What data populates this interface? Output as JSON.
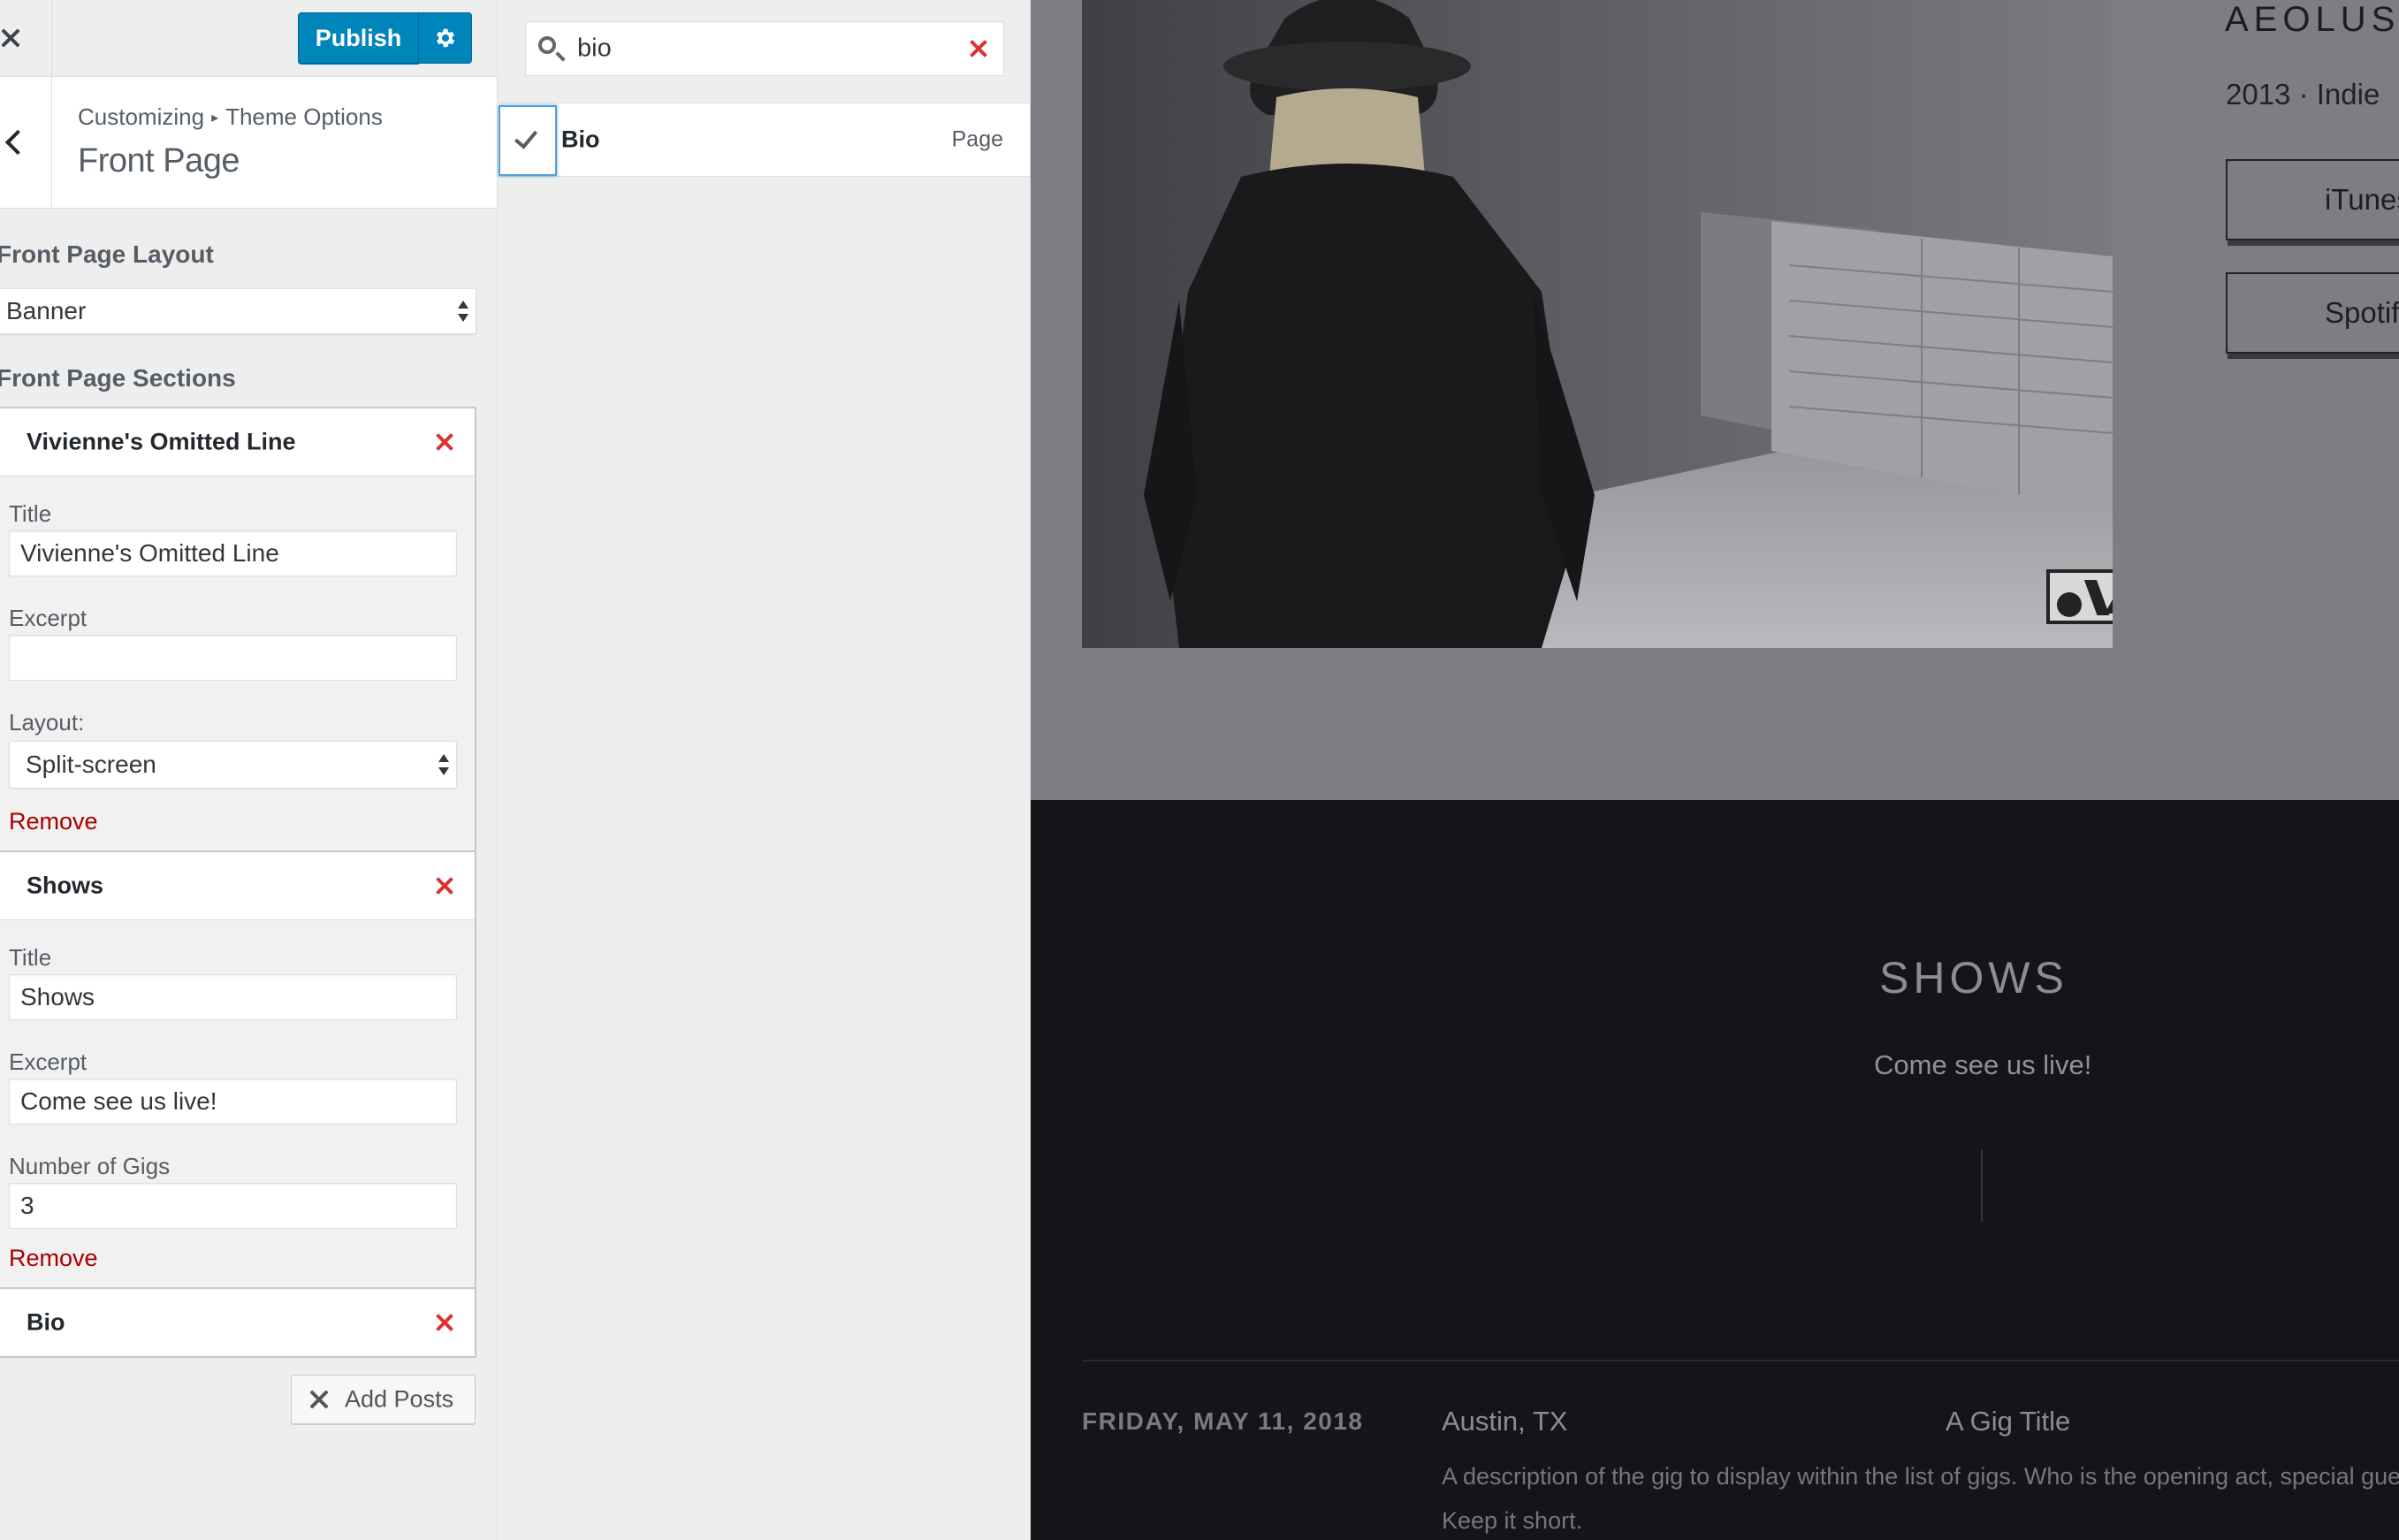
{
  "topbar": {
    "close_icon": "close-icon",
    "publish_label": "Publish",
    "settings_icon": "gear-icon"
  },
  "section_header": {
    "breadcrumb_part1": "Customizing",
    "breadcrumb_separator": "▸",
    "breadcrumb_part2": "Theme Options",
    "title": "Front Page"
  },
  "layout": {
    "heading": "Front Page Layout",
    "selected": "Banner"
  },
  "sections": {
    "heading": "Front Page Sections",
    "items": [
      {
        "name": "Vivienne's Omitted Line",
        "title_label": "Title",
        "title_value": "Vivienne's Omitted Line",
        "excerpt_label": "Excerpt",
        "excerpt_value": "",
        "layout_label": "Layout:",
        "layout_value": "Split-screen",
        "remove_label": "Remove"
      },
      {
        "name": "Shows",
        "title_label": "Title",
        "title_value": "Shows",
        "excerpt_label": "Excerpt",
        "excerpt_value": "Come see us live!",
        "gigs_label": "Number of Gigs",
        "gigs_value": "3",
        "remove_label": "Remove"
      },
      {
        "name": "Bio"
      }
    ],
    "add_posts_label": "Add Posts"
  },
  "available_items": {
    "search_value": "bio",
    "results": [
      {
        "title": "Bio",
        "type": "Page",
        "selected": true
      }
    ]
  },
  "preview": {
    "album_title": "AEOLUS",
    "album_meta": "2013 · Indie",
    "store_buttons": [
      "iTunes",
      "Spotify"
    ],
    "shows_title": "SHOWS",
    "shows_excerpt": "Come see us live!",
    "gig": {
      "date": "FRIDAY, MAY 11, 2018",
      "location": "Austin, TX",
      "title": "A Gig Title",
      "description_line1": "A description of the gig to display within the list of gigs. Who is the opening act, special guests...",
      "description_line2": "Keep it short."
    }
  },
  "colors": {
    "publish_blue": "#0085ba",
    "remove_red": "#aa0000",
    "close_red": "#dc3232",
    "shows_bg": "#141419"
  }
}
